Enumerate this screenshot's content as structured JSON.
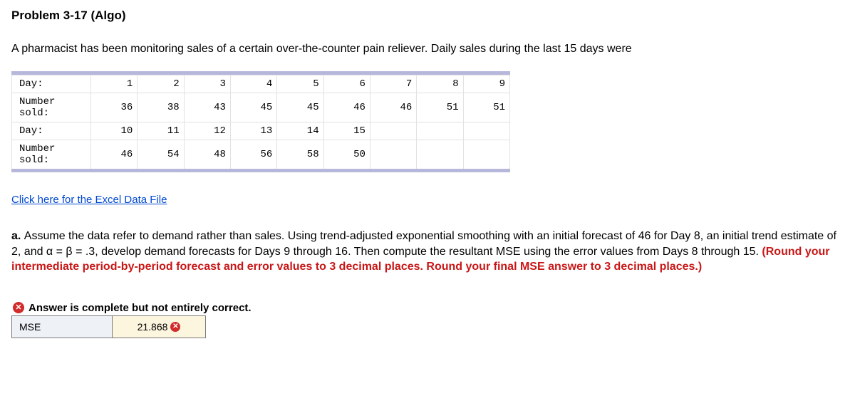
{
  "title": "Problem 3-17 (Algo)",
  "intro": "A pharmacist has been monitoring sales of a certain over-the-counter pain reliever. Daily sales during the last 15 days were",
  "data_rows": {
    "r1_label": "Day:",
    "r1": [
      "1",
      "2",
      "3",
      "4",
      "5",
      "6",
      "7",
      "8",
      "9"
    ],
    "r2_label": "Number sold:",
    "r2": [
      "36",
      "38",
      "43",
      "45",
      "45",
      "46",
      "46",
      "51",
      "51"
    ],
    "r3_label": "Day:",
    "r3": [
      "10",
      "11",
      "12",
      "13",
      "14",
      "15",
      "",
      "",
      ""
    ],
    "r4_label": "Number sold:",
    "r4": [
      "46",
      "54",
      "48",
      "56",
      "58",
      "50",
      "",
      "",
      ""
    ]
  },
  "excel_link": "Click here for the Excel Data File",
  "question_a_prefix": "a. ",
  "question_a_body": "Assume the data refer to demand rather than sales. Using trend-adjusted exponential smoothing with an initial forecast of 46 for Day 8, an initial trend estimate of 2, and α = β = .3, develop demand forecasts for Days 9 through 16. Then compute the resultant MSE using the error values from Days 8 through 15. ",
  "question_a_red": "(Round your intermediate period-by-period forecast and error values to 3 decimal places. Round your final MSE answer to 3 decimal places.)",
  "answer_status": "Answer is complete but not entirely correct.",
  "mse_label": "MSE",
  "mse_value": "21.868"
}
